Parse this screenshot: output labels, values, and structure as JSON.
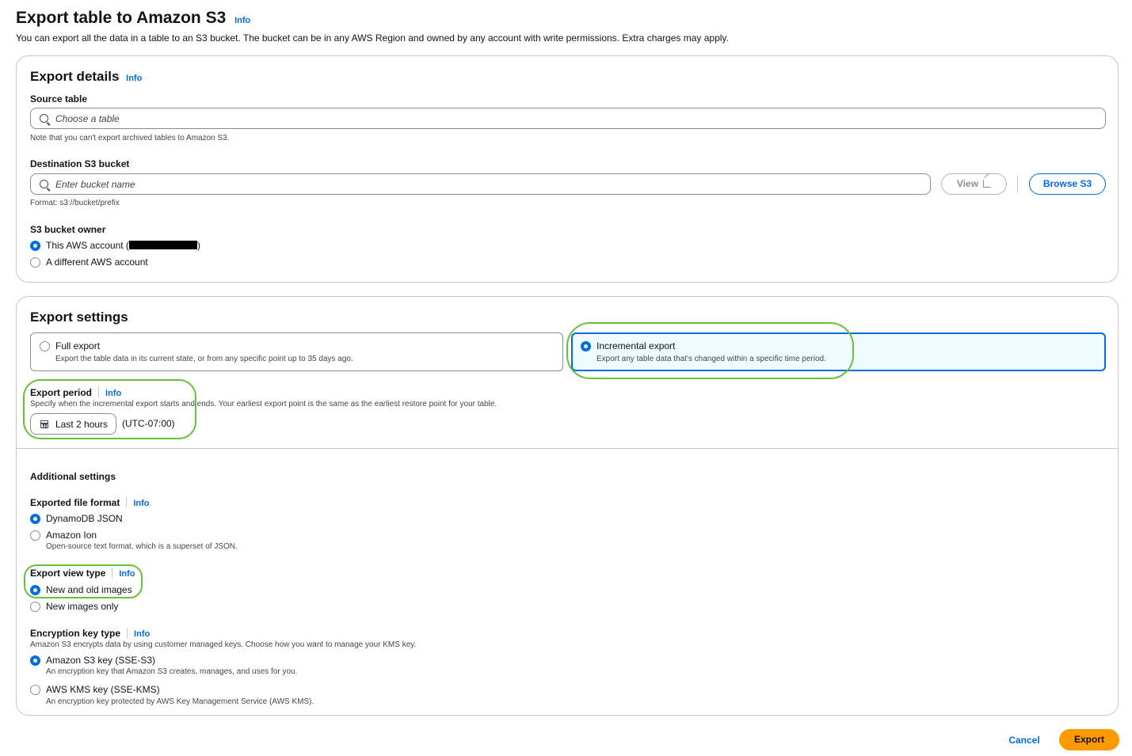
{
  "page": {
    "title": "Export table to Amazon S3",
    "info": "Info",
    "description": "You can export all the data in a table to an S3 bucket. The bucket can be in any AWS Region and owned by any account with write permissions. Extra charges may apply."
  },
  "export_details": {
    "heading": "Export details",
    "info": "Info",
    "source_table": {
      "label": "Source table",
      "placeholder": "Choose a table",
      "hint": "Note that you can't export archived tables to Amazon S3."
    },
    "destination": {
      "label": "Destination S3 bucket",
      "placeholder": "Enter bucket name",
      "hint": "Format: s3://bucket/prefix",
      "view_label": "View",
      "browse_label": "Browse S3"
    },
    "owner": {
      "label": "S3 bucket owner",
      "options": [
        {
          "label_prefix": "This AWS account (",
          "label_suffix": ")",
          "selected": true
        },
        {
          "label": "A different AWS account",
          "selected": false
        }
      ]
    }
  },
  "export_settings": {
    "heading": "Export settings",
    "tiles": [
      {
        "title": "Full export",
        "description": "Export the table data in its current state, or from any specific point up to 35 days ago.",
        "selected": false
      },
      {
        "title": "Incremental export",
        "description": "Export any table data that's changed within a specific time period.",
        "selected": true
      }
    ],
    "period": {
      "label": "Export period",
      "info": "Info",
      "description": "Specify when the incremental export starts and ends. Your earliest export point is the same as the earliest restore point for your table.",
      "value": "Last 2 hours",
      "timezone": "(UTC-07:00)"
    },
    "additional": {
      "heading": "Additional settings",
      "file_format": {
        "label": "Exported file format",
        "info": "Info",
        "options": [
          {
            "label": "DynamoDB JSON",
            "selected": true
          },
          {
            "label": "Amazon Ion",
            "description": "Open-source text format, which is a superset of JSON.",
            "selected": false
          }
        ]
      },
      "view_type": {
        "label": "Export view type",
        "info": "Info",
        "options": [
          {
            "label": "New and old images",
            "selected": true
          },
          {
            "label": "New images only",
            "selected": false
          }
        ]
      },
      "encryption": {
        "label": "Encryption key type",
        "info": "Info",
        "description": "Amazon S3 encrypts data by using customer managed keys. Choose how you want to manage your KMS key.",
        "options": [
          {
            "label": "Amazon S3 key (SSE-S3)",
            "description": "An encryption key that Amazon S3 creates, manages, and uses for you.",
            "selected": true
          },
          {
            "label": "AWS KMS key (SSE-KMS)",
            "description": "An encryption key protected by AWS Key Management Service (AWS KMS).",
            "selected": false
          }
        ]
      }
    }
  },
  "footer": {
    "cancel_label": "Cancel",
    "export_label": "Export"
  },
  "colors": {
    "accent": "#006ce0",
    "primary_button": "#ff9900",
    "highlight": "#68c03b"
  }
}
